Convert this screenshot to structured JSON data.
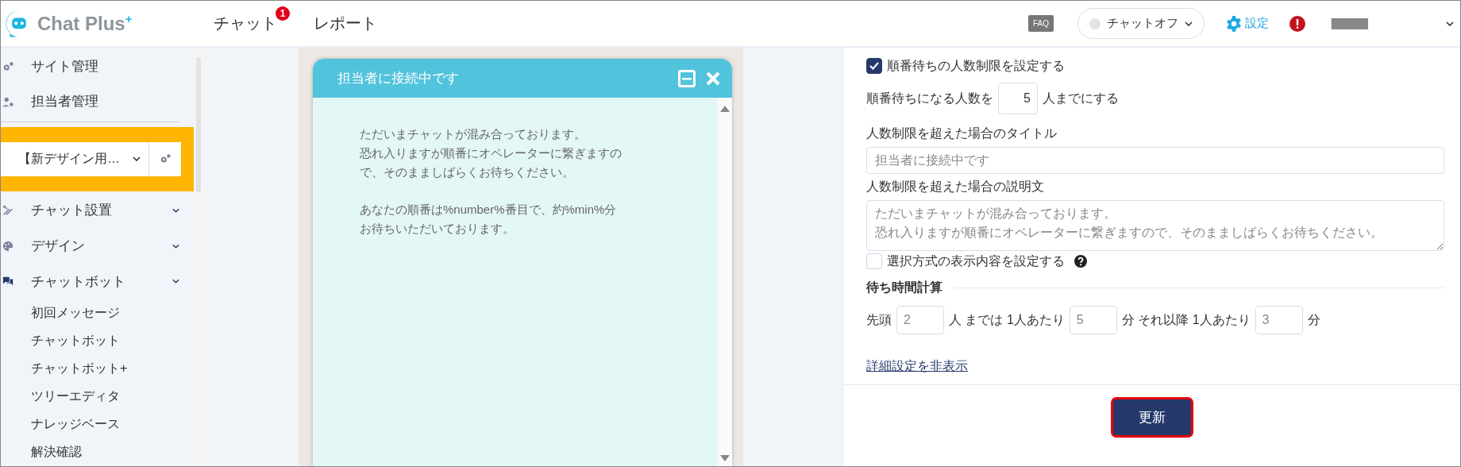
{
  "header": {
    "logo": {
      "text": "Chat Plus",
      "mark": "+"
    },
    "nav": [
      {
        "label": "チャット",
        "badge": "1"
      },
      {
        "label": "レポート"
      }
    ],
    "faq_label": "FAQ",
    "status_dropdown": {
      "label": "チャットオフ",
      "online": false
    },
    "settings_link": "設定"
  },
  "sidebar": {
    "top_items": [
      {
        "label": "サイト管理"
      },
      {
        "label": "担当者管理"
      }
    ],
    "site_select": {
      "value": "【新デザイン用…"
    },
    "menu": [
      {
        "label": "チャット設置"
      },
      {
        "label": "デザイン"
      },
      {
        "label": "チャットボット",
        "children": [
          {
            "label": "初回メッセージ"
          },
          {
            "label": "チャットボット"
          },
          {
            "label": "チャットボット+"
          },
          {
            "label": "ツリーエディタ"
          },
          {
            "label": "ナレッジベース"
          },
          {
            "label": "解決確認"
          }
        ]
      }
    ]
  },
  "preview": {
    "title": "担当者に接続中です",
    "paragraphs": [
      [
        "ただいまチャットが混み合っております。",
        "恐れ入りますが順番にオペレーターに繋ぎますの",
        "で、そのまましばらくお待ちください。"
      ],
      [
        "あなたの順番は%number%番目で、約%min%分",
        "お待ちいただいております。"
      ]
    ]
  },
  "settings": {
    "limit_checkbox": {
      "label": "順番待ちの人数制限を設定する",
      "checked": true
    },
    "queue_count": {
      "prefix": "順番待ちになる人数を",
      "value": "5",
      "suffix": "人までにする"
    },
    "title_field": {
      "label": "人数制限を超えた場合のタイトル",
      "placeholder": "担当者に接続中です"
    },
    "description_field": {
      "label": "人数制限を超えた場合の説明文",
      "placeholder_lines": [
        "ただいまチャットが混み合っております。",
        "恐れ入りますが順番にオペレーターに繋ぎますので、そのまましばらくお待ちください。"
      ]
    },
    "choice_checkbox": {
      "label": "選択方式の表示内容を設定する",
      "checked": false
    },
    "wait_section": {
      "heading": "待ち時間計算",
      "row": [
        {
          "kind": "text",
          "text": "先頭"
        },
        {
          "kind": "input",
          "placeholder": "2"
        },
        {
          "kind": "text",
          "text": "人 までは 1人あたり"
        },
        {
          "kind": "input",
          "placeholder": "5"
        },
        {
          "kind": "text",
          "text": "分 それ以降 1人あたり"
        },
        {
          "kind": "input",
          "placeholder": "3"
        },
        {
          "kind": "text",
          "text": "分"
        }
      ]
    },
    "toggle_link": "詳細設定を非表示",
    "submit_button": "更新"
  }
}
